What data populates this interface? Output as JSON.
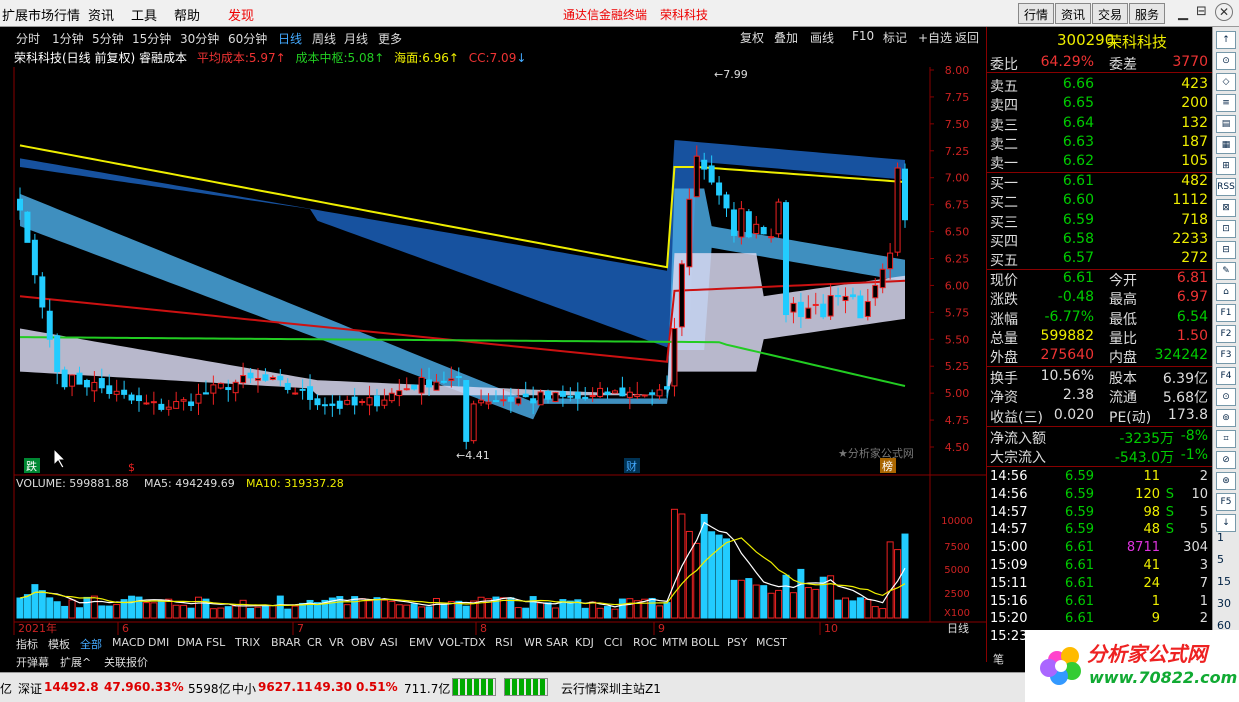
{
  "menu": {
    "items": [
      "扩展市场行情",
      "资讯",
      "工具",
      "帮助",
      "发现"
    ],
    "brand": "通达信金融终端",
    "stock_name": "荣科科技",
    "right_buttons": [
      "行情",
      "资讯",
      "交易",
      "服务"
    ]
  },
  "periods": [
    "分时",
    "1分钟",
    "5分钟",
    "15分钟",
    "30分钟",
    "60分钟",
    "日线",
    "周线",
    "月线",
    "更多"
  ],
  "active_period": "日线",
  "toolbar": [
    "复权",
    "叠加",
    "画线",
    "F10",
    "标记",
    "+自选",
    "返回"
  ],
  "indicator": {
    "name": "荣科科技(日线 前复权) 睿融成本",
    "avg_cost_label": "平均成本:",
    "avg_cost": "5.97",
    "center_label": "成本中枢:",
    "center": "5.08",
    "haidi_label": "海面:",
    "haidi": "6.96",
    "cc_label": "CC:",
    "cc": "7.09"
  },
  "price_axis": [
    "8.00",
    "7.75",
    "7.50",
    "7.25",
    "7.00",
    "6.75",
    "6.50",
    "6.25",
    "6.00",
    "5.75",
    "5.50",
    "5.25",
    "5.00",
    "4.75",
    "4.50"
  ],
  "annotations": {
    "high": "7.99",
    "low": "4.41",
    "tag_die": "跌",
    "tag_s": "$",
    "tag_cai": "财",
    "tag_bang": "榜",
    "watermark": "分析家公式网"
  },
  "volume": {
    "label": "VOLUME: 599881.88",
    "ma5": "MA5: 494249.69",
    "ma10": "MA10: 319337.28",
    "axis": [
      "10000",
      "7500",
      "5000",
      "2500",
      "X100"
    ]
  },
  "date_labels": [
    "2021年",
    "6",
    "7",
    "8",
    "9",
    "10"
  ],
  "period_tag": "日线",
  "quote": {
    "code": "300290",
    "name": "荣科科技",
    "weibi_label": "委比",
    "weibi": "64.29%",
    "weicha_label": "委差",
    "weicha": "3770",
    "asks": [
      {
        "l": "卖五",
        "p": "6.66",
        "v": "423"
      },
      {
        "l": "卖四",
        "p": "6.65",
        "v": "200"
      },
      {
        "l": "卖三",
        "p": "6.64",
        "v": "132"
      },
      {
        "l": "卖二",
        "p": "6.63",
        "v": "187"
      },
      {
        "l": "卖一",
        "p": "6.62",
        "v": "105"
      }
    ],
    "bids": [
      {
        "l": "买一",
        "p": "6.61",
        "v": "482"
      },
      {
        "l": "买二",
        "p": "6.60",
        "v": "1112"
      },
      {
        "l": "买三",
        "p": "6.59",
        "v": "718"
      },
      {
        "l": "买四",
        "p": "6.58",
        "v": "2233"
      },
      {
        "l": "买五",
        "p": "6.57",
        "v": "272"
      }
    ],
    "stats": [
      {
        "l1": "现价",
        "v1": "6.61",
        "l2": "今开",
        "v2": "6.81",
        "c1": "#0c0",
        "c2": "#e33"
      },
      {
        "l1": "涨跌",
        "v1": "-0.48",
        "l2": "最高",
        "v2": "6.97",
        "c1": "#0c0",
        "c2": "#e33"
      },
      {
        "l1": "涨幅",
        "v1": "-6.77%",
        "l2": "最低",
        "v2": "6.54",
        "c1": "#0c0",
        "c2": "#0c0"
      },
      {
        "l1": "总量",
        "v1": "599882",
        "l2": "量比",
        "v2": "1.50",
        "c1": "#ee0",
        "c2": "#e33"
      },
      {
        "l1": "外盘",
        "v1": "275640",
        "l2": "内盘",
        "v2": "324242",
        "c1": "#e33",
        "c2": "#0c0"
      },
      {
        "l1": "换手",
        "v1": "10.56%",
        "l2": "股本",
        "v2": "6.39亿",
        "c1": "#ddd",
        "c2": "#ddd"
      },
      {
        "l1": "净资",
        "v1": "2.38",
        "l2": "流通",
        "v2": "5.68亿",
        "c1": "#ddd",
        "c2": "#ddd"
      },
      {
        "l1": "收益(三)",
        "v1": "0.020",
        "l2": "PE(动)",
        "v2": "173.8",
        "c1": "#ddd",
        "c2": "#ddd"
      }
    ],
    "flow": [
      {
        "l": "净流入额",
        "v": "-3235万",
        "p": "-8%"
      },
      {
        "l": "大宗流入",
        "v": "-543.0万",
        "p": "-1%"
      }
    ],
    "ticks": [
      {
        "t": "14:56",
        "p": "6.59",
        "v": "11",
        "s": "",
        "n": "2"
      },
      {
        "t": "14:56",
        "p": "6.59",
        "v": "120",
        "s": "S",
        "n": "10"
      },
      {
        "t": "14:57",
        "p": "6.59",
        "v": "98",
        "s": "S",
        "n": "5"
      },
      {
        "t": "14:57",
        "p": "6.59",
        "v": "48",
        "s": "S",
        "n": "5"
      },
      {
        "t": "15:00",
        "p": "6.61",
        "v": "8711",
        "s": "",
        "n": "304"
      },
      {
        "t": "15:09",
        "p": "6.61",
        "v": "41",
        "s": "",
        "n": "3"
      },
      {
        "t": "15:11",
        "p": "6.61",
        "v": "24",
        "s": "",
        "n": "7"
      },
      {
        "t": "15:16",
        "p": "6.61",
        "v": "1",
        "s": "",
        "n": "1"
      },
      {
        "t": "15:20",
        "p": "6.61",
        "v": "9",
        "s": "",
        "n": "2"
      },
      {
        "t": "15:23",
        "p": "6.61",
        "v": "",
        "s": "",
        "n": ""
      }
    ]
  },
  "side_labels": [
    "1",
    "5",
    "15",
    "30",
    "60"
  ],
  "tabs": [
    "指标",
    "模板",
    "全部",
    "MACD",
    "DMI",
    "DMA",
    "FSL",
    "TRIX",
    "BRAR",
    "CR",
    "VR",
    "OBV",
    "ASI",
    "EMV",
    "VOL-TDX",
    "RSI",
    "WR",
    "SAR",
    "KDJ",
    "CCI",
    "ROC",
    "MTM",
    "BOLL",
    "PSY",
    "MCST"
  ],
  "bottom2": [
    "开弹幕",
    "扩展^",
    "关联报价"
  ],
  "status": {
    "sz_label": "深证",
    "sz": "14492.8",
    "sz_chg": "47.96",
    "sz_pct": "0.33%",
    "sz_amt": "5598亿",
    "zx_label": "中小",
    "zx": "9627.11",
    "zx_chg": "49.30",
    "zx_pct": "0.51%",
    "zx_amt": "711.7亿",
    "server": "云行情深圳主站Z1"
  },
  "logo": {
    "text": "分析家公式网",
    "url": "www.70822.com"
  }
}
